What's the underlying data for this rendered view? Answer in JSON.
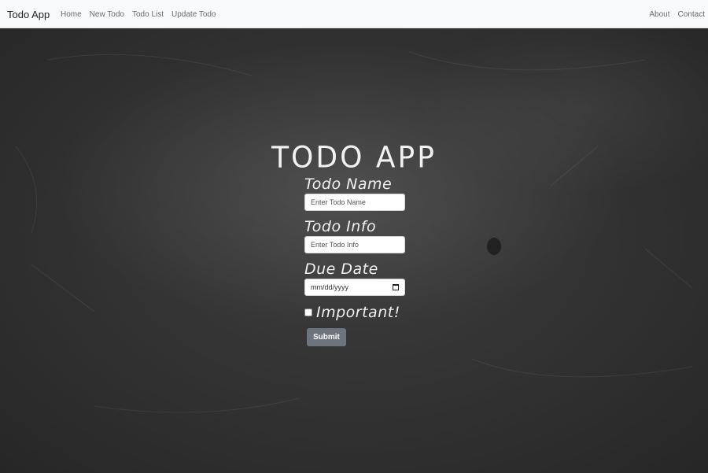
{
  "navbar": {
    "brand": "Todo App",
    "left_links": [
      "Home",
      "New Todo",
      "Todo List",
      "Update Todo"
    ],
    "right_links": [
      "About",
      "Contact"
    ]
  },
  "page": {
    "title": "TODO APP"
  },
  "form": {
    "name_label": "Todo Name",
    "name_placeholder": "Enter Todo Name",
    "info_label": "Todo Info",
    "info_placeholder": "Enter Todo Info",
    "date_label": "Due Date",
    "date_value": "mm/dd/yyyy",
    "important_label": "Important!",
    "important_checked": false,
    "submit_label": "Submit"
  },
  "colors": {
    "navbar_bg": "#f8f9fa",
    "chalkboard": "#2c2c2c",
    "submit_bg": "#6c757d",
    "chalk_text": "#f0f0f0"
  }
}
